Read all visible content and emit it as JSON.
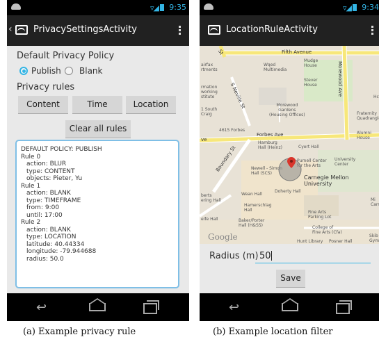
{
  "phone_a": {
    "status": {
      "time": "9:35"
    },
    "action_bar": {
      "title": "PrivacySettingsActivity"
    },
    "default_policy_label": "Default Privacy Policy",
    "publish_label": "Publish",
    "blank_label": "Blank",
    "selected_option": "Publish",
    "privacy_rules_label": "Privacy rules",
    "buttons": {
      "content": "Content",
      "time": "Time",
      "location": "Location",
      "clear_all": "Clear all rules"
    },
    "rules_lines": [
      "DEFAULT POLICY: PUBLISH",
      "Rule 0",
      "action: BLUR",
      "type: CONTENT",
      "objects: Pieter, Yu",
      "Rule 1",
      "action: BLANK",
      "type: TIMEFRAME",
      "from: 9:00",
      "until: 17:00",
      "Rule 2",
      "action: BLANK",
      "type: LOCATION",
      "latitude: 40.44334",
      "longitude: -79.944688",
      "radius: 50.0"
    ],
    "caption": "(a) Example privacy rule"
  },
  "phone_b": {
    "status": {
      "time": "9:34"
    },
    "action_bar": {
      "title": "LocationRuleActivity"
    },
    "map": {
      "streets": {
        "fifth": "Fifth Avenue",
        "forbes": "Forbes Ave",
        "morewood": "Morewood Ave",
        "boundary": "Boundary St",
        "neville": "S Neville St",
        "st": "St",
        "ave": "ve"
      },
      "places": {
        "wqed": "Wqed\nMultimedia",
        "mudge": "Mudge\nHouse",
        "stever": "Stever\nHouse",
        "fairfax": "airfax\nrtments",
        "ormation": "rmation\nworking\nstitute",
        "south_craig": "1 South\nCraig",
        "morewood_gardens": "Morewood\nGardens\n(Housing Offices)",
        "fraternity": "Fraternity\nQuadrangle",
        "forbes4615": "4615 Forbes",
        "alumni": "Alumni\nHouse",
        "hamburg": "Hamburg\nHall (Heinz)",
        "cyert": "Cyert Hall",
        "purnell": "Purnell Center\nfor the Arts",
        "university_center": "University\nCenter",
        "newell_simon": "Newell - Simon\nHall (SCS)",
        "cmu": "Carnegie Mellon\nUniversity",
        "wean": "Wean Hall",
        "doherty": "Doherty Hall",
        "berts": "berts\nering Hall",
        "hamerschlag": "Hamerschlag\nHall",
        "baker": "Baker/Porter\nHall (H&SS)",
        "fine_arts_lot": "Fine Arts\nParking Lot",
        "college_fine_arts": "College of\nFine Arts (Cfa)",
        "eife": "eife Hall",
        "hunt": "Hunt Library",
        "posner": "Posner Hall",
        "skib": "Skib\nGymna",
        "mi": "Mi\nCarn",
        "hc": "Hc"
      },
      "watermark": "Google",
      "radius_color": "#8a8a8a",
      "pin_color": "#d9352b"
    },
    "radius_label": "Radius (m)",
    "radius_value": "50",
    "save_label": "Save",
    "caption": "(b) Example location filter"
  },
  "colors": {
    "accent": "#33b5e5",
    "action_bar": "#212121",
    "status_bar": "#000000",
    "background": "#e9e9e9"
  }
}
